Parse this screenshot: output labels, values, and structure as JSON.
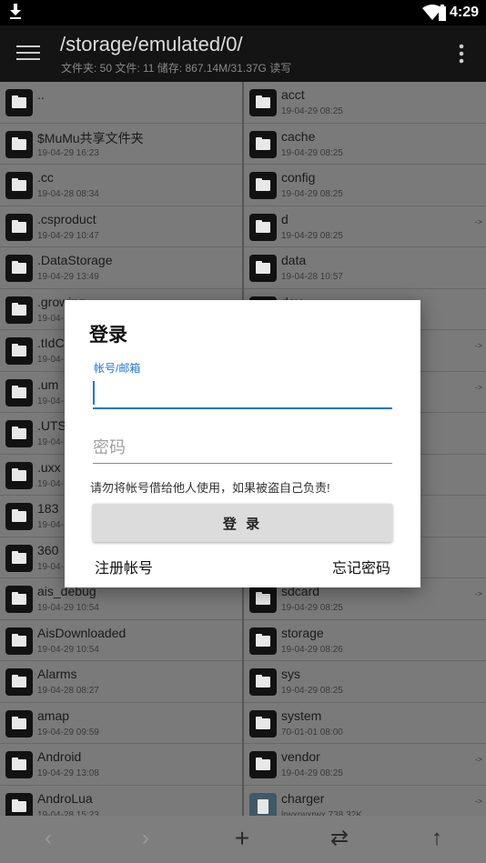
{
  "status_bar": {
    "time": "4:29"
  },
  "app_bar": {
    "path": "/storage/emulated/0/",
    "stats": "文件夹: 50  文件: 11  储存: 867.14M/31.37G  读写"
  },
  "left_files": [
    {
      "name": "..",
      "meta": ""
    },
    {
      "name": "$MuMu共享文件夹",
      "meta": "19-04-29 16:23"
    },
    {
      "name": ".cc",
      "meta": "19-04-28 08:34"
    },
    {
      "name": ".csproduct",
      "meta": "19-04-29 10:47"
    },
    {
      "name": ".DataStorage",
      "meta": "19-04-29 13:49"
    },
    {
      "name": ".growing",
      "meta": "19-04-"
    },
    {
      "name": ".tIdC",
      "meta": "19-04-"
    },
    {
      "name": ".um",
      "meta": "19-04-"
    },
    {
      "name": ".UTS",
      "meta": "19-04-"
    },
    {
      "name": ".uxx",
      "meta": "19-04-"
    },
    {
      "name": "183",
      "meta": "19-04-"
    },
    {
      "name": "360",
      "meta": "19-04-"
    },
    {
      "name": "ais_debug",
      "meta": "19-04-29 10:54"
    },
    {
      "name": "AisDownloaded",
      "meta": "19-04-29 10:54"
    },
    {
      "name": "Alarms",
      "meta": "19-04-28 08:27"
    },
    {
      "name": "amap",
      "meta": "19-04-29 09:59"
    },
    {
      "name": "Android",
      "meta": "19-04-29 13:08"
    },
    {
      "name": "AndroLua",
      "meta": "19-04-28 15:23"
    }
  ],
  "right_files": [
    {
      "name": "acct",
      "meta": "19-04-29 08:25",
      "link": ""
    },
    {
      "name": "cache",
      "meta": "19-04-29 08:25",
      "link": ""
    },
    {
      "name": "config",
      "meta": "19-04-29 08:25",
      "link": ""
    },
    {
      "name": "d",
      "meta": "19-04-29 08:25",
      "link": "->"
    },
    {
      "name": "data",
      "meta": "19-04-28 10:57",
      "link": ""
    },
    {
      "name": "dev",
      "meta": "",
      "link": ""
    },
    {
      "name": "",
      "meta": "",
      "link": "->"
    },
    {
      "name": "",
      "meta": "",
      "link": "->"
    },
    {
      "name": "",
      "meta": "",
      "link": ""
    },
    {
      "name": "",
      "meta": "",
      "link": ""
    },
    {
      "name": "",
      "meta": "",
      "link": ""
    },
    {
      "name": "",
      "meta": "",
      "link": ""
    },
    {
      "name": "sdcard",
      "meta": "19-04-29 08:25",
      "link": "->"
    },
    {
      "name": "storage",
      "meta": "19-04-29 08:26",
      "link": ""
    },
    {
      "name": "sys",
      "meta": "19-04-29 08:25",
      "link": ""
    },
    {
      "name": "system",
      "meta": "70-01-01 08:00",
      "link": ""
    },
    {
      "name": "vendor",
      "meta": "19-04-29 08:25",
      "link": "->"
    },
    {
      "name": "charger",
      "meta": "lrwxrwxrwx 738.32K",
      "link": "->",
      "type": "file"
    }
  ],
  "dialog": {
    "title": "登录",
    "account_label": "帐号/邮箱",
    "account_value": "",
    "password_placeholder": "密码",
    "warning": "请勿将帐号借给他人使用，如果被盗自己负责!",
    "login_button": "登 录",
    "register_link": "注册帐号",
    "forgot_link": "忘记密码"
  },
  "bottom_bar": {
    "back_icon": "chevron-left-icon",
    "forward_icon": "chevron-right-icon",
    "add_icon": "plus-icon",
    "swap_icon": "swap-icon",
    "up_icon": "arrow-up-icon"
  },
  "colors": {
    "accent": "#1976d2",
    "dim": "#7a7a7a",
    "appbar": "#141414"
  }
}
